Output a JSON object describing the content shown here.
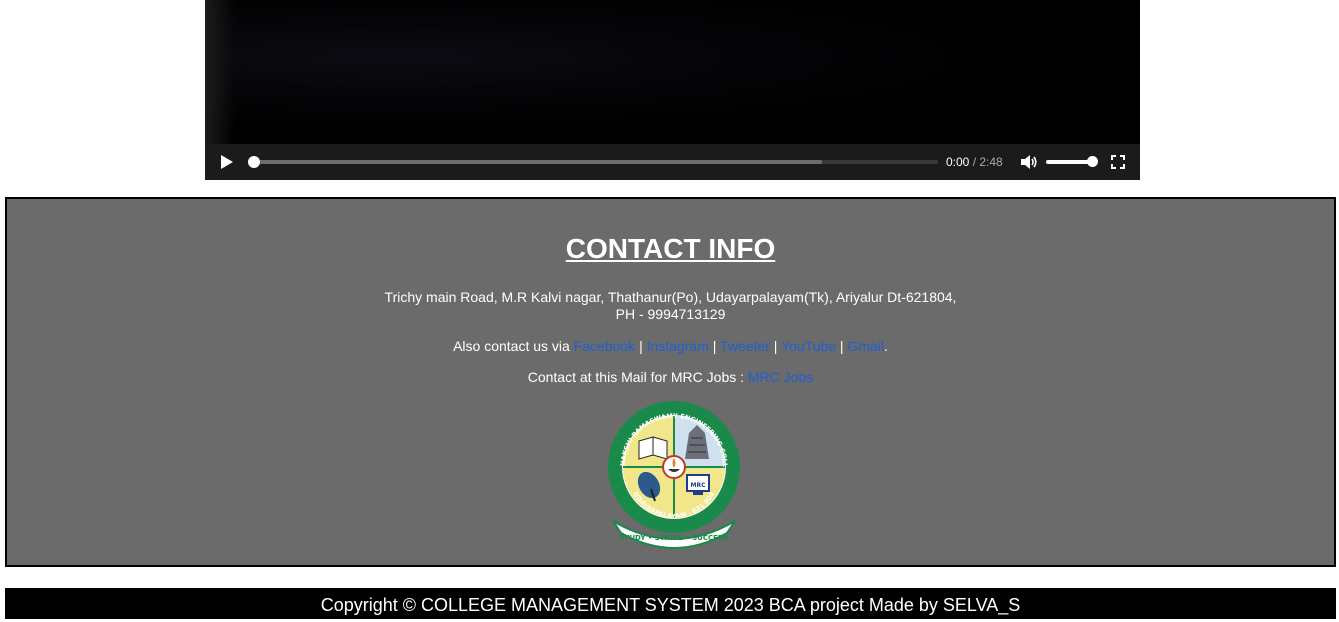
{
  "video": {
    "current_time": "0:00",
    "separator": " / ",
    "duration": "2:48",
    "progress_fraction": 0,
    "buffered_fraction": 0.83,
    "volume_fraction": 1.0
  },
  "contact": {
    "heading": "CONTACT INFO",
    "address_line1": "Trichy main Road, M.R Kalvi nagar, Thathanur(Po), Udayarpalayam(Tk), Ariyalur Dt-621804,",
    "address_line2": "PH - 9994713129",
    "social_prefix": "Also contact us via ",
    "links": [
      "Facebook",
      "Instagram",
      "Tweeter",
      "YouTube",
      "Gmail"
    ],
    "link_separator": " | ",
    "social_suffix": ".",
    "mail_prefix": "Contact at this Mail for MRC Jobs : ",
    "mail_link": "MRC Jobs",
    "logo": {
      "ring_text": "MEENAKSHI RAMASWAMY ENGINEERING COLLEGE",
      "bottom_text": "UDAYARPALAYAM - 621 804",
      "emblem_text": "MRC",
      "motto": "STUDY • STRIVE • SUCCEED"
    }
  },
  "footer": {
    "text": "Copyright © COLLEGE MANAGEMENT SYSTEM 2023 BCA project Made by SELVA_S"
  },
  "colors": {
    "contact_bg": "#6b6b6b",
    "link": "#1f5fd1",
    "logo_green": "#1a8a4a",
    "logo_yellow": "#f2e68a"
  }
}
